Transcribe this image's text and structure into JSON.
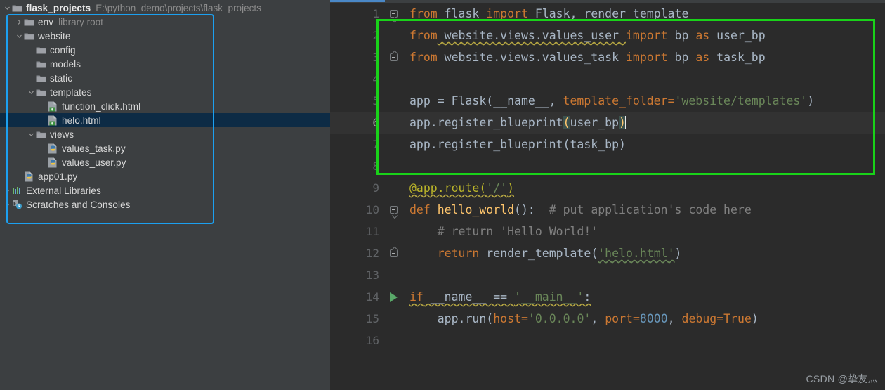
{
  "project": {
    "name": "flask_projects",
    "path": "E:\\python_demo\\projects\\flask_projects",
    "root_icon": "folder-icon",
    "collapse_icon": "chevron-down-icon"
  },
  "sidebar": {
    "items": [
      {
        "label": "env",
        "sublabel": "library root",
        "icon": "folder-icon",
        "arrow": "chevron-right-icon",
        "indent": 1,
        "selected": false
      },
      {
        "label": "website",
        "sublabel": "",
        "icon": "folder-icon",
        "arrow": "chevron-down-icon",
        "indent": 1,
        "selected": false
      },
      {
        "label": "config",
        "sublabel": "",
        "icon": "folder-icon",
        "arrow": "",
        "indent": 2,
        "selected": false
      },
      {
        "label": "models",
        "sublabel": "",
        "icon": "folder-icon",
        "arrow": "",
        "indent": 2,
        "selected": false
      },
      {
        "label": "static",
        "sublabel": "",
        "icon": "folder-icon",
        "arrow": "",
        "indent": 2,
        "selected": false
      },
      {
        "label": "templates",
        "sublabel": "",
        "icon": "folder-icon",
        "arrow": "chevron-down-icon",
        "indent": 2,
        "selected": false
      },
      {
        "label": "function_click.html",
        "sublabel": "",
        "icon": "html-file-icon",
        "arrow": "",
        "indent": 3,
        "selected": false
      },
      {
        "label": "helo.html",
        "sublabel": "",
        "icon": "html-file-icon",
        "arrow": "",
        "indent": 3,
        "selected": true
      },
      {
        "label": "views",
        "sublabel": "",
        "icon": "folder-icon",
        "arrow": "chevron-down-icon",
        "indent": 2,
        "selected": false
      },
      {
        "label": "values_task.py",
        "sublabel": "",
        "icon": "python-file-icon",
        "arrow": "",
        "indent": 3,
        "selected": false
      },
      {
        "label": "values_user.py",
        "sublabel": "",
        "icon": "python-file-icon",
        "arrow": "",
        "indent": 3,
        "selected": false
      },
      {
        "label": "app01.py",
        "sublabel": "",
        "icon": "python-file-icon",
        "arrow": "",
        "indent": 1,
        "selected": false
      },
      {
        "label": "External Libraries",
        "sublabel": "",
        "icon": "libraries-icon",
        "arrow": "chevron-right-icon",
        "indent": 0,
        "selected": false
      },
      {
        "label": "Scratches and Consoles",
        "sublabel": "",
        "icon": "scratches-icon",
        "arrow": "chevron-right-icon",
        "indent": 0,
        "selected": false
      }
    ]
  },
  "editor": {
    "current_line": 6,
    "run_line": 14,
    "line_numbers": [
      "1",
      "2",
      "3",
      "4",
      "5",
      "6",
      "7",
      "8",
      "9",
      "10",
      "11",
      "12",
      "13",
      "14",
      "15",
      "16"
    ],
    "lines": [
      "from flask import Flask, render_template",
      "from website.views.values_user import bp as user_bp",
      "from website.views.values_task import bp as task_bp",
      "",
      "app = Flask(__name__, template_folder='website/templates')",
      "app.register_blueprint(user_bp)",
      "app.register_blueprint(task_bp)",
      "",
      "@app.route('/')",
      "def hello_world():  # put application's code here",
      "    # return 'Hello World!'",
      "    return render_template('helo.html')",
      "",
      "if __name__ == '__main__':",
      "    app.run(host='0.0.0.0', port=8000, debug=True)",
      ""
    ],
    "tokens": {
      "l1": {
        "kw_from": "from",
        "mod": " flask ",
        "kw_import": "import",
        "rest": " Flask, render_template"
      },
      "l2": {
        "kw_from": "from",
        "mod": " website.views.values_user ",
        "kw_import": "import",
        "bp": " bp ",
        "kw_as": "as",
        "alias": " user_bp"
      },
      "l3": {
        "kw_from": "from",
        "mod": " website.views.values_task ",
        "kw_import": "import",
        "bp": " bp ",
        "kw_as": "as",
        "alias": " task_bp"
      },
      "l5": {
        "a": "app = Flask(__name__, ",
        "kwarg": "template_folder",
        "eq": "=",
        "str": "'website/templates'",
        "close": ")"
      },
      "l6": {
        "a": "app.register_blueprint",
        "open": "(",
        "arg": "user_bp",
        "close": ")"
      },
      "l7": {
        "a": "app.register_blueprint(task_bp)"
      },
      "l9": {
        "dec": "@app.route",
        "p1": "(",
        "str": "'/'",
        "p2": ")"
      },
      "l10": {
        "kw": "def",
        "name": " hello_world",
        "par": "():",
        "comment": "  # put application's code here"
      },
      "l11": {
        "indent": "    ",
        "comment": "# return 'Hello World!'"
      },
      "l12": {
        "indent": "    ",
        "kw": "return",
        "name": " render_template",
        "p1": "(",
        "str": "'helo.html'",
        "p2": ")"
      },
      "l14": {
        "kw": "if",
        "name": " __name__ ",
        "op": "== ",
        "str": "'__main__'",
        "colon": ":"
      },
      "l15": {
        "indent": "    ",
        "a": "app.run",
        "p1": "(",
        "k1": "host",
        "e1": "=",
        "s1": "'0.0.0.0'",
        "c1": ", ",
        "k2": "port",
        "e2": "=",
        "n2": "8000",
        "c2": ", ",
        "k3": "debug",
        "e3": "=",
        "v3": "True",
        "p2": ")"
      }
    }
  },
  "watermark": "CSDN @挚友灬",
  "colors": {
    "sidebar_bg": "#3c3f41",
    "editor_bg": "#2b2b2b",
    "selection_bg": "#0d2b45",
    "selection_border": "#1ca0f0",
    "highlight_border": "#19d219",
    "keyword": "#cc7832",
    "string": "#6a8759",
    "number": "#6897bb",
    "comment": "#808080",
    "decorator": "#bbb529",
    "text": "#a9b7c6",
    "run_arrow": "#59a869"
  }
}
